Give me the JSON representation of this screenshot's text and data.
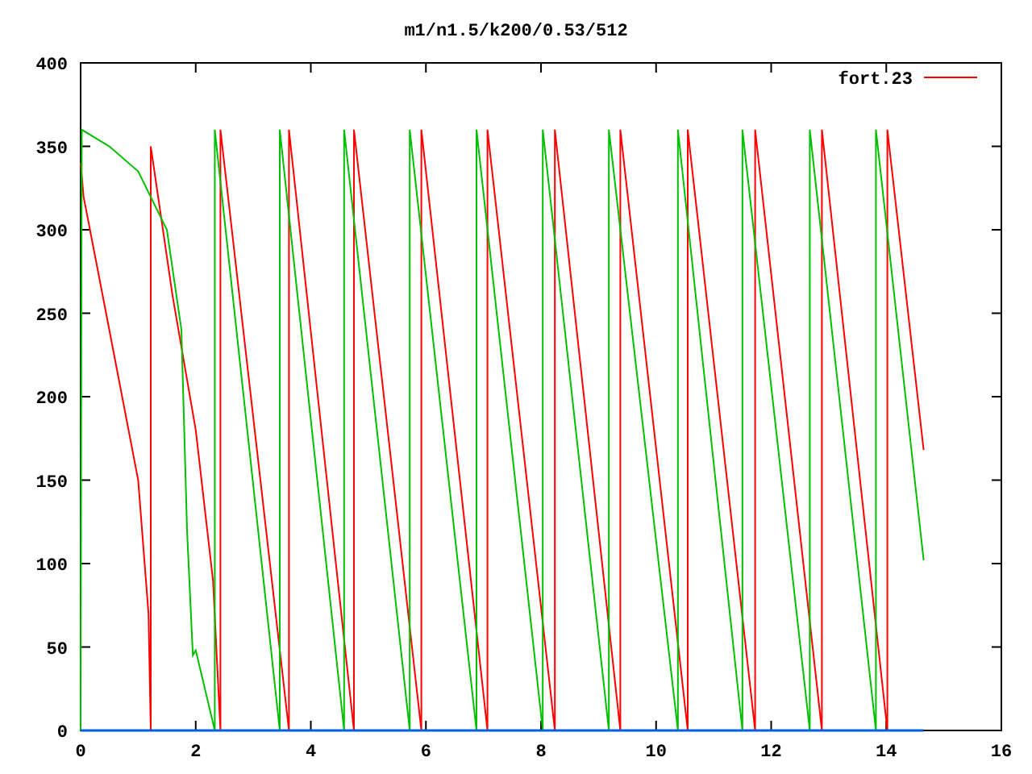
{
  "chart_data": {
    "type": "line",
    "title": "m1/n1.5/k200/0.53/512",
    "xlim": [
      0,
      16
    ],
    "ylim": [
      0,
      400
    ],
    "xticks": [
      0,
      2,
      4,
      6,
      8,
      10,
      12,
      14,
      16
    ],
    "yticks": [
      0,
      50,
      100,
      150,
      200,
      250,
      300,
      350,
      400
    ],
    "series": [
      {
        "name": "fort.23",
        "color": "#ff0000",
        "x": [
          0,
          0.05,
          0.5,
          1.0,
          1.18,
          1.22,
          1.22,
          1.6,
          2.0,
          2.3,
          2.43,
          2.43,
          3.62,
          3.62,
          4.75,
          4.75,
          5.92,
          5.92,
          7.07,
          7.07,
          8.24,
          8.24,
          9.38,
          9.38,
          10.55,
          10.55,
          11.72,
          11.72,
          12.88,
          12.88,
          14.02,
          14.02,
          14.65
        ],
        "values": [
          340,
          320,
          240,
          150,
          70,
          0,
          350,
          260,
          180,
          90,
          0,
          360,
          0,
          360,
          0,
          360,
          0,
          360,
          0,
          360,
          0,
          360,
          0,
          360,
          0,
          360,
          0,
          360,
          0,
          360,
          0,
          360,
          168
        ]
      },
      {
        "color": "#00c000",
        "x": [
          0,
          0.02,
          0.02,
          0.5,
          1.0,
          1.5,
          1.75,
          1.85,
          1.95,
          2.0,
          2.33,
          2.33,
          3.46,
          3.46,
          4.58,
          4.58,
          5.72,
          5.72,
          6.88,
          6.88,
          8.03,
          8.03,
          9.18,
          9.18,
          10.38,
          10.38,
          11.5,
          11.5,
          12.67,
          12.67,
          13.82,
          13.82,
          14.65
        ],
        "values": [
          0,
          360,
          360,
          350,
          335,
          300,
          240,
          120,
          45,
          48,
          0,
          360,
          0,
          360,
          0,
          360,
          0,
          360,
          0,
          360,
          0,
          360,
          0,
          360,
          0,
          360,
          0,
          360,
          0,
          360,
          0,
          360,
          102
        ]
      },
      {
        "color": "#0060e0",
        "x": [
          0,
          14.65
        ],
        "values": [
          0,
          0
        ]
      }
    ]
  }
}
